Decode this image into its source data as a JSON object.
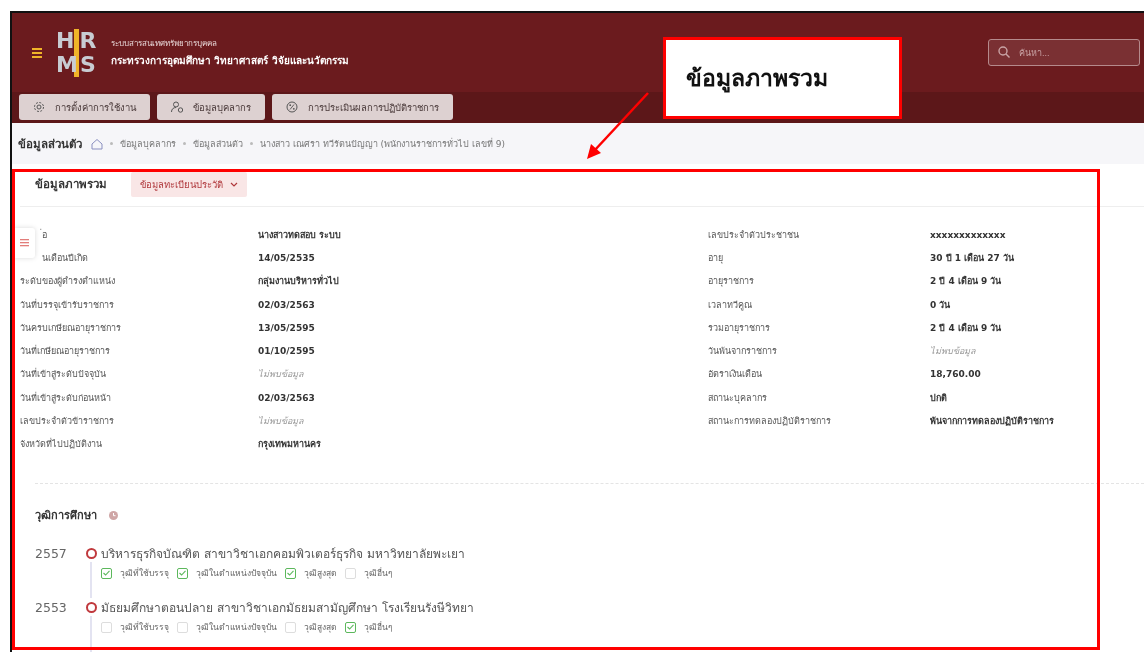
{
  "header": {
    "logo_letters": [
      "H",
      "R",
      "M",
      "S"
    ],
    "subtitle": "ระบบสารสนเทศทรัพยากรบุคคล",
    "title": "กระทรวงการอุดมศึกษา วิทยาศาสตร์ วิจัยและนวัตกรรม",
    "search": {
      "placeholder": "ค้นหา..."
    }
  },
  "nav_tabs": [
    {
      "label": "การตั้งค่าการใช้งาน"
    },
    {
      "label": "ข้อมูลบุคลากร"
    },
    {
      "label": "การประเมินผลการปฏิบัติราชการ"
    }
  ],
  "breadcrumb": {
    "title": "ข้อมูลส่วนตัว",
    "items": [
      "ข้อมูลบุคลากร",
      "ข้อมูลส่วนตัว",
      "นางสาว เณศรา ทวีรัตนปัญญา (พนักงานราชการทั่วไป เลขที่ 9)"
    ]
  },
  "card_tabs": [
    {
      "label": "ข้อมูลภาพรวม",
      "selected": true,
      "dropdown": false
    },
    {
      "label": "ข้อมูลทะเบียนประวัติ",
      "selected": false,
      "dropdown": true
    }
  ],
  "left_fields": [
    {
      "label": "่อ",
      "value": "นางสาวทดสอบ   ระบบ",
      "empty": false
    },
    {
      "label": "นเดือนปีเกิด",
      "value": "14/05/2535",
      "empty": false
    },
    {
      "label": "ระดับของผู้ดำรงตำแหน่ง",
      "value": "กลุ่มงานบริหารทั่วไป",
      "empty": false
    },
    {
      "label": "วันที่บรรจุเข้ารับราชการ",
      "value": "02/03/2563",
      "empty": false
    },
    {
      "label": "วันครบเกษียณอายุราชการ",
      "value": "13/05/2595",
      "empty": false
    },
    {
      "label": "วันที่เกษียณอายุราชการ",
      "value": "01/10/2595",
      "empty": false
    },
    {
      "label": "วันที่เข้าสู่ระดับปัจจุบัน",
      "value": "ไม่พบข้อมูล",
      "empty": true
    },
    {
      "label": "วันที่เข้าสู่ระดับก่อนหน้า",
      "value": "02/03/2563",
      "empty": false
    },
    {
      "label": "เลขประจำตัวข้าราชการ",
      "value": "ไม่พบข้อมูล",
      "empty": true
    },
    {
      "label": "จังหวัดที่ไปปฏิบัติงาน",
      "value": "กรุงเทพมหานคร",
      "empty": false
    }
  ],
  "right_fields": [
    {
      "label": "เลขประจำตัวประชาชน",
      "value": "xxxxxxxxxxxxx",
      "empty": false
    },
    {
      "label": "อายุ",
      "value": "30 ปี 1 เดือน 27 วัน",
      "empty": false
    },
    {
      "label": "อายุราชการ",
      "value": "2 ปี 4 เดือน 9 วัน",
      "empty": false
    },
    {
      "label": "เวลาทวีคูณ",
      "value": "0 วัน",
      "empty": false
    },
    {
      "label": "รวมอายุราชการ",
      "value": "2 ปี 4 เดือน 9 วัน",
      "empty": false
    },
    {
      "label": "วันพ้นจากราชการ",
      "value": "ไม่พบข้อมูล",
      "empty": true
    },
    {
      "label": "อัตราเงินเดือน",
      "value": "18,760.00",
      "empty": false
    },
    {
      "label": "สถานะบุคลากร",
      "value": "ปกติ",
      "empty": false
    },
    {
      "label": "สถานะการทดลองปฏิบัติราชการ",
      "value": "พ้นจากการทดลองปฏิบัติราชการ",
      "empty": false
    }
  ],
  "education": {
    "title": "วุฒิการศึกษา",
    "entries": [
      {
        "year": "2557",
        "text": "บริหารธุรกิจบัณฑิต สาขาวิชาเอกคอมพิวเตอร์ธุรกิจ มหาวิทยาลัยพะเยา",
        "flags": [
          {
            "label": "วุฒิที่ใช้บรรจุ",
            "checked": true
          },
          {
            "label": "วุฒิในตำแหน่งปัจจุบัน",
            "checked": true
          },
          {
            "label": "วุฒิสูงสุด",
            "checked": true
          },
          {
            "label": "วุฒิอื่นๆ",
            "checked": false
          }
        ]
      },
      {
        "year": "2553",
        "text": "มัธยมศึกษาตอนปลาย สาขาวิชาเอกมัธยมสามัญศึกษา โรงเรียนรังษีวิทยา",
        "flags": [
          {
            "label": "วุฒิที่ใช้บรรจุ",
            "checked": false
          },
          {
            "label": "วุฒิในตำแหน่งปัจจุบัน",
            "checked": false
          },
          {
            "label": "วุฒิสูงสุด",
            "checked": false
          },
          {
            "label": "วุฒิอื่นๆ",
            "checked": true
          }
        ]
      }
    ]
  },
  "annotation": {
    "callout": "ข้อมูลภาพรวม"
  }
}
